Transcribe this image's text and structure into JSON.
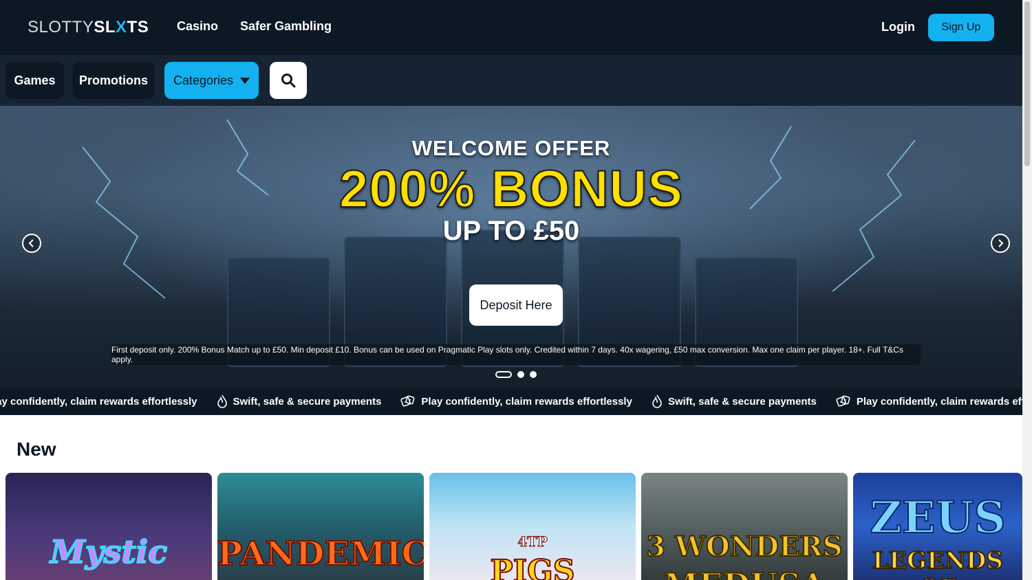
{
  "header": {
    "logo_part1": "SLOTTY",
    "logo_part2_a": "SL",
    "logo_part2_x": "X",
    "logo_part2_b": "TS",
    "nav": [
      "Casino",
      "Safer Gambling"
    ],
    "login_label": "Login",
    "signup_label": "Sign Up"
  },
  "catbar": {
    "games_label": "Games",
    "promotions_label": "Promotions",
    "categories_label": "Categories",
    "search_icon": "search-icon"
  },
  "hero": {
    "welcome": "WELCOME OFFER",
    "bonus": "200% BONUS",
    "upto": "UP TO £50",
    "cta": "Deposit Here",
    "terms": "First deposit only. 200% Bonus Match up to £50. Min deposit £10. Bonus can be used on Pragmatic Play slots only. Credited within 7 days. 40x wagering, £50 max conversion. Max one claim per player. 18+. Full T&Cs apply.",
    "slides_total": 3,
    "active_slide": 1
  },
  "ticker": {
    "items": [
      {
        "icon": "dice-icon",
        "text": "lay confidently, claim rewards effortlessly"
      },
      {
        "icon": "flame-icon",
        "text": "Swift, safe & secure payments"
      },
      {
        "icon": "dice-icon",
        "text": "Play confidently, claim rewards effortlessly"
      },
      {
        "icon": "flame-icon",
        "text": "Swift, safe & secure payments"
      },
      {
        "icon": "dice-icon",
        "text": "Play confidently, claim rewards effortlessly"
      },
      {
        "icon": "flame-icon",
        "text": ""
      }
    ]
  },
  "new_section": {
    "title": "New",
    "games": [
      {
        "title": "Mystic"
      },
      {
        "title": "PANDEMIC"
      },
      {
        "title": "PIGS",
        "badge": "4TP"
      },
      {
        "title": "3 WONDERS",
        "subtitle": "MEDUSA"
      },
      {
        "title": "ZEUS",
        "subtitle": "LEGENDS OF"
      }
    ]
  },
  "colors": {
    "navy": "#0c1824",
    "accent": "#14b1f0",
    "bonus_yellow": "#ffe000"
  }
}
